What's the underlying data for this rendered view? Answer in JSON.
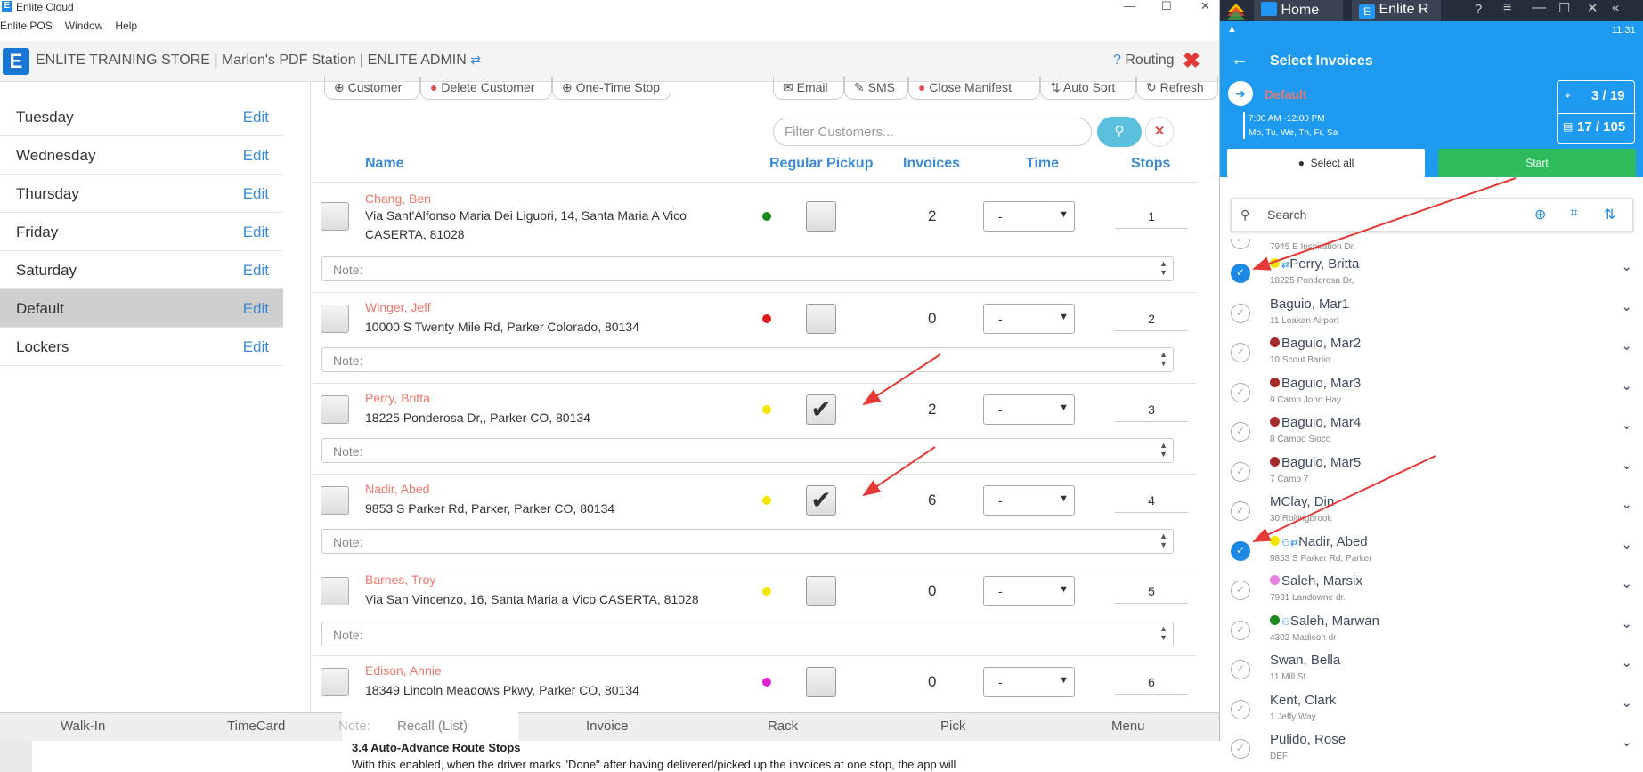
{
  "window": {
    "title": "Enlite Cloud",
    "menu": [
      "Enlite POS",
      "Window",
      "Help"
    ],
    "store_line": "ENLITE TRAINING STORE | Marlon's PDF Station | ENLITE ADMIN",
    "routing_label": "Routing"
  },
  "days": [
    {
      "name": "Tuesday",
      "edit": "Edit",
      "selected": false
    },
    {
      "name": "Wednesday",
      "edit": "Edit",
      "selected": false
    },
    {
      "name": "Thursday",
      "edit": "Edit",
      "selected": false
    },
    {
      "name": "Friday",
      "edit": "Edit",
      "selected": false
    },
    {
      "name": "Saturday",
      "edit": "Edit",
      "selected": false
    },
    {
      "name": "Default",
      "edit": "Edit",
      "selected": true
    },
    {
      "name": "Lockers",
      "edit": "Edit",
      "selected": false
    }
  ],
  "toolbar": {
    "customer": "Customer",
    "delete_customer": "Delete Customer",
    "one_time_stop": "One-Time Stop",
    "email": "Email",
    "sms": "SMS",
    "close_manifest": "Close Manifest",
    "auto_sort": "Auto Sort",
    "refresh": "Refresh"
  },
  "filter": {
    "placeholder": "Filter Customers..."
  },
  "table": {
    "headers": {
      "name": "Name",
      "regular_pickup": "Regular Pickup",
      "invoices": "Invoices",
      "time": "Time",
      "stops": "Stops"
    },
    "note_placeholder": "Note:",
    "rows": [
      {
        "name": "Chang, Ben",
        "address": "Via Sant'Alfonso Maria Dei Liguori, 14, Santa Maria A Vico CASERTA, 81028",
        "dot_color": "#1a8a1a",
        "pickup_checked": false,
        "invoices": "2",
        "time": "-",
        "stop": "1"
      },
      {
        "name": "Winger, Jeff",
        "address": "10000 S Twenty Mile Rd, Parker Colorado, 80134",
        "dot_color": "#e01818",
        "pickup_checked": false,
        "invoices": "0",
        "time": "-",
        "stop": "2"
      },
      {
        "name": "Perry, Britta",
        "address": "18225 Ponderosa Dr,, Parker CO, 80134",
        "dot_color": "#f2e600",
        "pickup_checked": true,
        "invoices": "2",
        "time": "-",
        "stop": "3"
      },
      {
        "name": "Nadir, Abed",
        "address": "9853 S Parker Rd, Parker, Parker CO, 80134",
        "dot_color": "#f2e600",
        "pickup_checked": true,
        "invoices": "6",
        "time": "-",
        "stop": "4"
      },
      {
        "name": "Barnes, Troy",
        "address": "Via San Vincenzo, 16, Santa Maria a Vico CASERTA, 81028",
        "dot_color": "#f2e600",
        "pickup_checked": false,
        "invoices": "0",
        "time": "-",
        "stop": "5"
      },
      {
        "name": "Edison, Annie",
        "address": "18349 Lincoln Meadows Pkwy, Parker CO, 80134",
        "dot_color": "#e020d0",
        "pickup_checked": false,
        "invoices": "0",
        "time": "-",
        "stop": "6"
      }
    ]
  },
  "bottom_nav": [
    "Walk-In",
    "TimeCard",
    "Recall (List)",
    "Invoice",
    "Rack",
    "Pick",
    "Menu"
  ],
  "bottom_nav_hidden_text": "Note:",
  "doc": {
    "heading": "3.4 Auto-Advance Route Stops",
    "text": "With this enabled, when the driver marks \"Done\" after having delivered/picked up the invoices at one stop, the app will"
  },
  "emulator": {
    "tabs": [
      "Home",
      "Enlite R"
    ],
    "clock": "11:31",
    "title": "Select Invoices",
    "route_name": "Default",
    "route_time": "7:00 AM -12:00 PM",
    "route_days": "Mo, Tu, We, Th, Fr, Sa",
    "stops_count": "3 / 19",
    "invoices_count": "17 / 105",
    "select_all": "Select all",
    "start": "Start",
    "search_placeholder": "Search",
    "partial_top_address": "7945 E Inspiration Dr,",
    "items": [
      {
        "name": "Perry, Britta",
        "address": "18225 Ponderosa Dr,",
        "checked": true,
        "dot": "#f2e600",
        "group": false,
        "recurring": true
      },
      {
        "name": "Baguio, Mar1",
        "address": "11 Loakan Airport",
        "checked": false,
        "dot": "",
        "group": false,
        "recurring": false
      },
      {
        "name": "Baguio, Mar2",
        "address": "10 Scout Bariio",
        "checked": false,
        "dot": "#a52a2a",
        "group": false,
        "recurring": false
      },
      {
        "name": "Baguio, Mar3",
        "address": "9 Camp John Hay",
        "checked": false,
        "dot": "#a52a2a",
        "group": false,
        "recurring": false
      },
      {
        "name": "Baguio, Mar4",
        "address": "8 Campo Sioco",
        "checked": false,
        "dot": "#a52a2a",
        "group": false,
        "recurring": false
      },
      {
        "name": "Baguio, Mar5",
        "address": "7 Camp 7",
        "checked": false,
        "dot": "#a52a2a",
        "group": false,
        "recurring": false
      },
      {
        "name": "MClay, Din",
        "address": "30 Rollingbrook",
        "checked": false,
        "dot": "",
        "group": false,
        "recurring": false
      },
      {
        "name": "Nadir, Abed",
        "address": "9853 S Parker Rd, Parker",
        "checked": true,
        "dot": "#f2e600",
        "group": true,
        "recurring": true
      },
      {
        "name": "Saleh, Marsix",
        "address": "7931 Landowne dr.",
        "checked": false,
        "dot": "#e87ee0",
        "group": false,
        "recurring": false
      },
      {
        "name": "Saleh, Marwan",
        "address": "4302 Madison dr",
        "checked": false,
        "dot": "#1a8a1a",
        "group": true,
        "recurring": false
      },
      {
        "name": "Swan, Bella",
        "address": "11 Mill St",
        "checked": false,
        "dot": "",
        "group": false,
        "recurring": false
      },
      {
        "name": "Kent, Clark",
        "address": "1 Jeffy Way",
        "checked": false,
        "dot": "",
        "group": false,
        "recurring": false
      },
      {
        "name": "Pulido, Rose",
        "address": "DEF",
        "checked": false,
        "dot": "",
        "group": false,
        "recurring": false
      }
    ]
  }
}
